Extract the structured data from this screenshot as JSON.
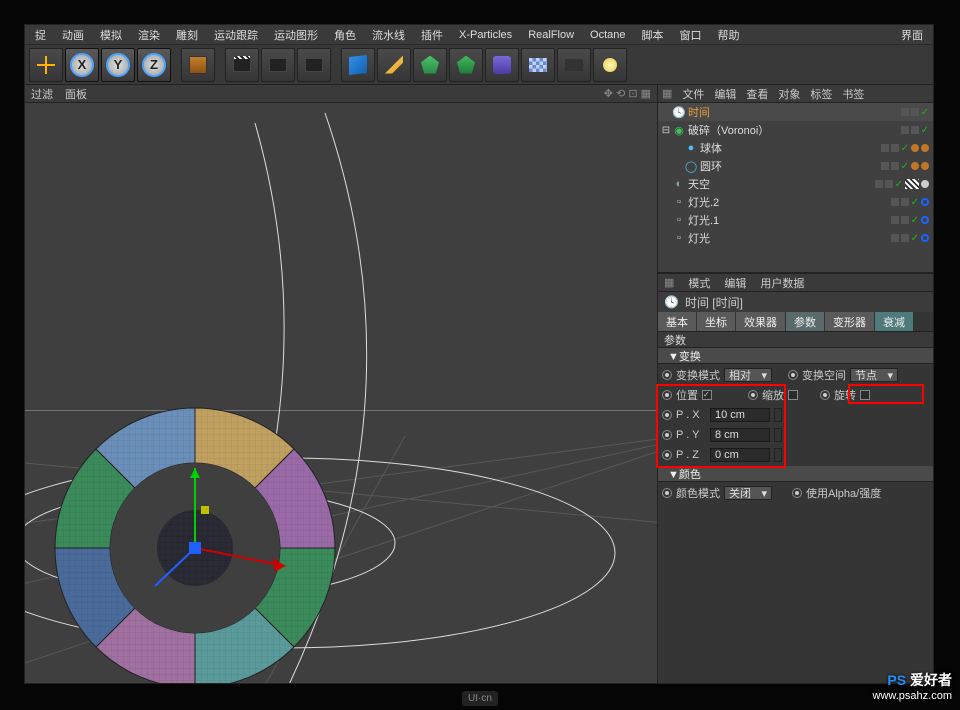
{
  "menu": {
    "items": [
      "捉",
      "动画",
      "模拟",
      "渲染",
      "雕刻",
      "运动跟踪",
      "运动图形",
      "角色",
      "流水线",
      "插件",
      "X-Particles",
      "RealFlow",
      "Octane",
      "脚本",
      "窗口",
      "帮助"
    ],
    "right": "界面"
  },
  "toolbar_axes": [
    "X",
    "Y",
    "Z"
  ],
  "view_header": {
    "left1": "过滤",
    "left2": "面板"
  },
  "om": {
    "menu": [
      "文件",
      "编辑",
      "查看",
      "对象",
      "标签",
      "书签"
    ],
    "items": [
      {
        "indent": 0,
        "exp": "",
        "icon": "clock",
        "label": "时间",
        "color": "#d59a3a",
        "sel": true
      },
      {
        "indent": 0,
        "exp": "⊟",
        "icon": "vor",
        "label": "破碎（Voronoi）",
        "color": "#3dc25a"
      },
      {
        "indent": 1,
        "exp": "",
        "icon": "sphere",
        "label": "球体",
        "color": "#4abdf0"
      },
      {
        "indent": 1,
        "exp": "",
        "icon": "torus",
        "label": "圆环",
        "color": "#4abdf0"
      },
      {
        "indent": 0,
        "exp": "",
        "icon": "sky",
        "label": "天空",
        "color": "#9aa"
      },
      {
        "indent": 0,
        "exp": "",
        "icon": "light",
        "label": "灯光.2",
        "color": "#ccc"
      },
      {
        "indent": 0,
        "exp": "",
        "icon": "light",
        "label": "灯光.1",
        "color": "#ccc"
      },
      {
        "indent": 0,
        "exp": "",
        "icon": "light",
        "label": "灯光",
        "color": "#ccc"
      }
    ]
  },
  "attr": {
    "menu": [
      "模式",
      "编辑",
      "用户数据"
    ],
    "title": "时间 [时间]",
    "tabs": [
      "基本",
      "坐标",
      "效果器",
      "参数",
      "变形器",
      "衰减"
    ],
    "section": "参数",
    "group_transform": "▼变换",
    "transform_mode_label": "变换模式",
    "transform_mode_value": "相对",
    "transform_space_label": "变换空间",
    "transform_space_value": "节点",
    "position_label": "位置",
    "scale_label": "缩放",
    "rotation_label": "旋转",
    "px_label": "P . X",
    "px_value": "10 cm",
    "py_label": "P . Y",
    "py_value": "8 cm",
    "pz_label": "P . Z",
    "pz_value": "0 cm",
    "group_color": "▼颜色",
    "color_mode_label": "颜色模式",
    "color_mode_value": "关闭",
    "alpha_label": "使用Alpha/强度"
  },
  "footer": "UI·cn",
  "watermark": {
    "brand": "PS 爱好者",
    "url": "www.psahz.com"
  },
  "chart_data": null
}
